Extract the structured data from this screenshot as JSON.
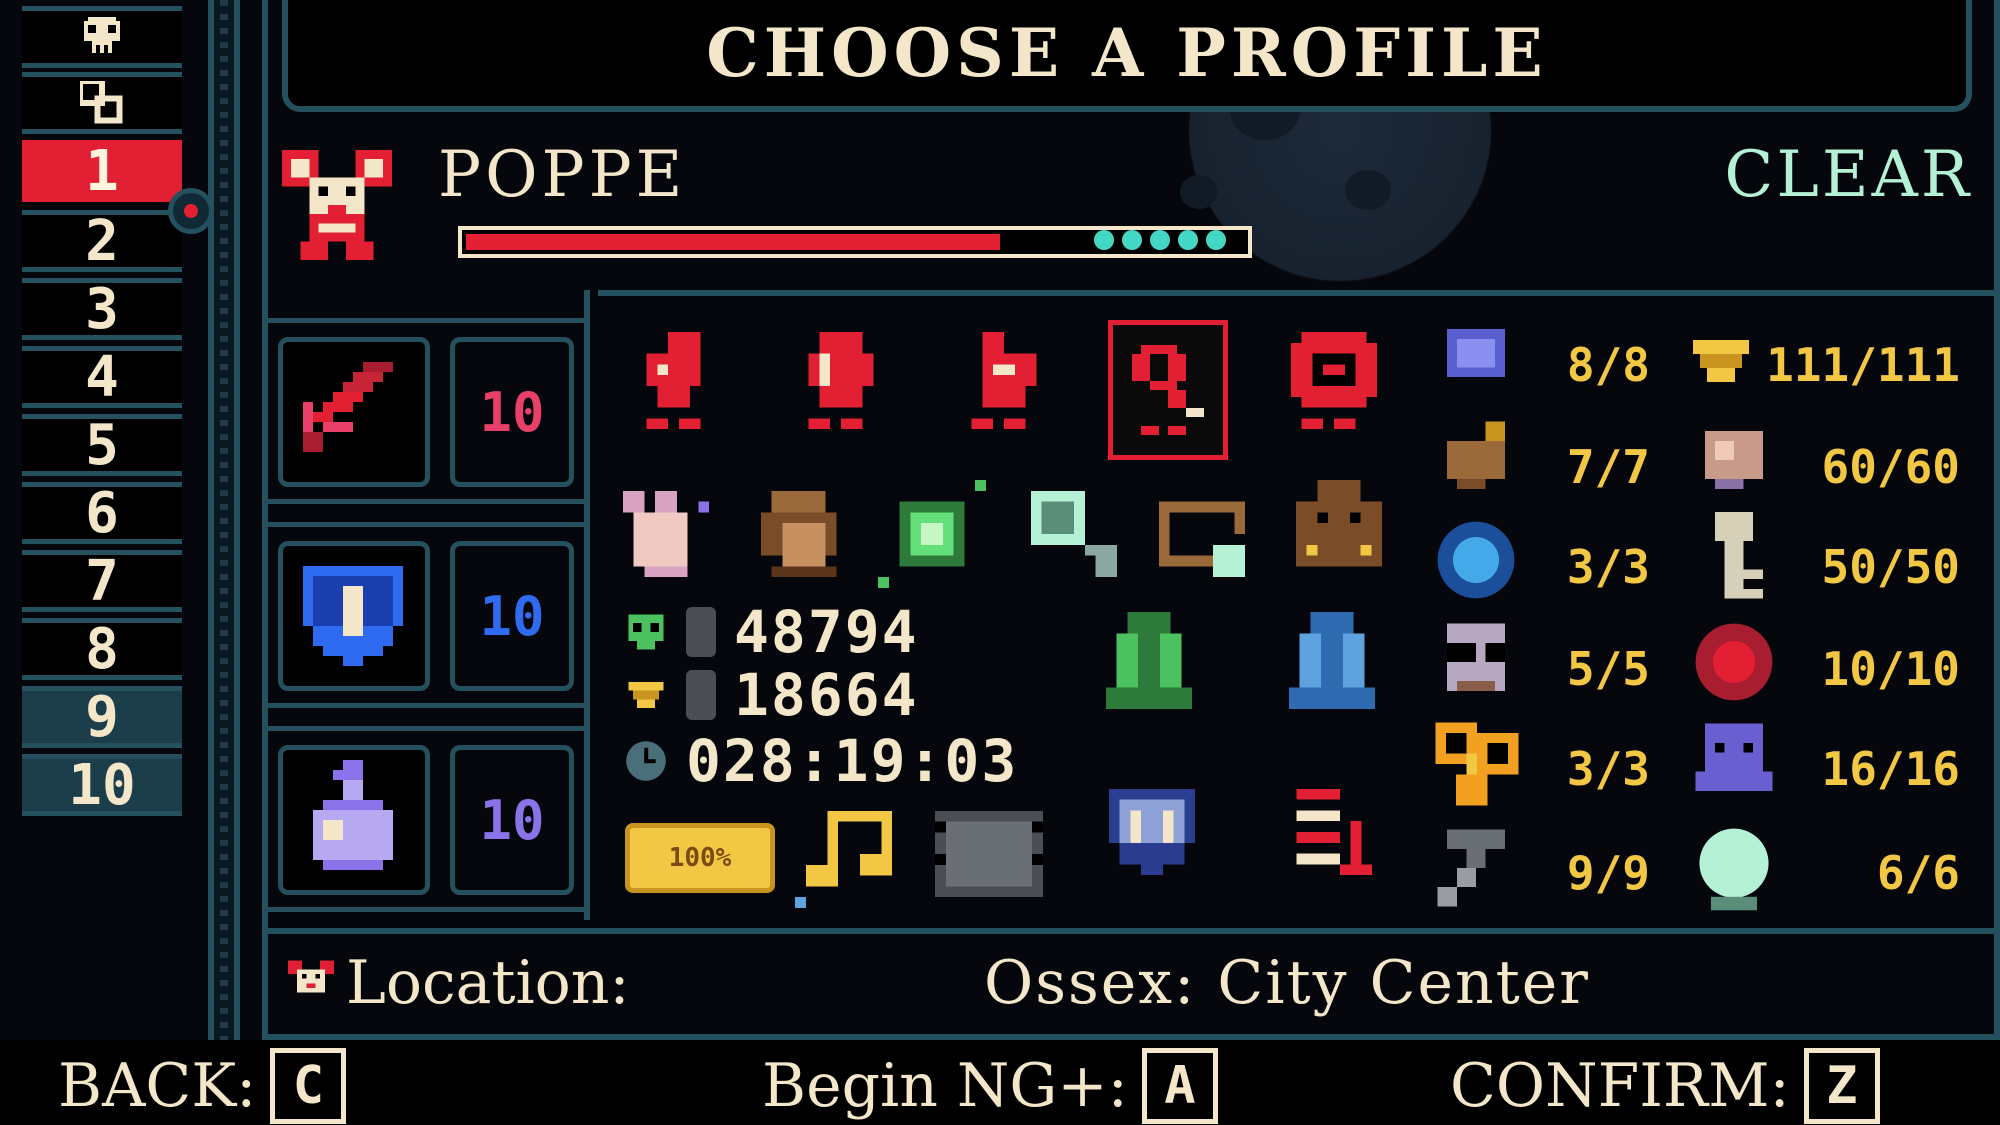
{
  "title": "CHOOSE A PROFILE",
  "profiles": {
    "slots": [
      "1",
      "2",
      "3",
      "4",
      "5",
      "6",
      "7",
      "8",
      "9",
      "10"
    ],
    "selected": "1",
    "top_icons": [
      "skull-icon",
      "swap-icon"
    ]
  },
  "profile": {
    "name": "POPPE",
    "status": "CLEAR",
    "progress": 0.68,
    "progress_gems": 5
  },
  "equipment": [
    {
      "icon": "sword-icon",
      "level": "10",
      "color": "#e8406b"
    },
    {
      "icon": "shield-icon",
      "level": "10",
      "color": "#2f6bf1"
    },
    {
      "icon": "potion-icon",
      "level": "10",
      "color": "#8a72e8"
    }
  ],
  "items_row1": [
    "red-trinket-1-icon",
    "red-trinket-2-icon",
    "red-trinket-3-icon",
    "red-trinket-selected-icon",
    "red-ring-icon"
  ],
  "items_row2": [
    "pink-creature-icon",
    "brown-hand-icon",
    "green-orb-icon",
    "magnifier-icon",
    "bracelet-icon",
    "brown-beast-icon"
  ],
  "items_row3": [
    "green-cloak-icon",
    "blue-cloak-icon"
  ],
  "items_row4": [
    "gold-bar-icon",
    "music-note-icon",
    "film-icon",
    "rank-ii-shield-icon",
    "spring-icon"
  ],
  "stats": {
    "kills": "48794",
    "gems": "18664",
    "time": "028:19:03"
  },
  "badges": {
    "gold_bar": "100%"
  },
  "collectibles_left": [
    {
      "icon": "blue-stone-icon",
      "count": "8/8"
    },
    {
      "icon": "acorn-icon",
      "count": "7/7"
    },
    {
      "icon": "blue-orb-icon",
      "count": "3/3"
    },
    {
      "icon": "glasses-cat-icon",
      "count": "5/5"
    },
    {
      "icon": "gold-key-icon",
      "count": "3/3"
    },
    {
      "icon": "pickaxe-icon",
      "count": "9/9"
    }
  ],
  "collectibles_right": [
    {
      "icon": "gem-icon",
      "count": "111/111"
    },
    {
      "icon": "rock-icon",
      "count": "60/60"
    },
    {
      "icon": "key-icon",
      "count": "50/50"
    },
    {
      "icon": "rose-icon",
      "count": "10/10"
    },
    {
      "icon": "purple-creature-icon",
      "count": "16/16"
    },
    {
      "icon": "crystal-ball-icon",
      "count": "6/6"
    }
  ],
  "location": {
    "label": "Location:",
    "value": "Ossex: City Center"
  },
  "footer": {
    "back_label": "BACK:",
    "back_key": "C",
    "ng_label": "Begin NG+:",
    "ng_key": "A",
    "confirm_label": "CONFIRM:",
    "confirm_key": "Z"
  },
  "colors": {
    "accent_red": "#e21f33",
    "frame_teal": "#25505e",
    "count_gold": "#f2c744",
    "clear_mint": "#b5f1d4",
    "text_cream": "#f3e6c9"
  }
}
